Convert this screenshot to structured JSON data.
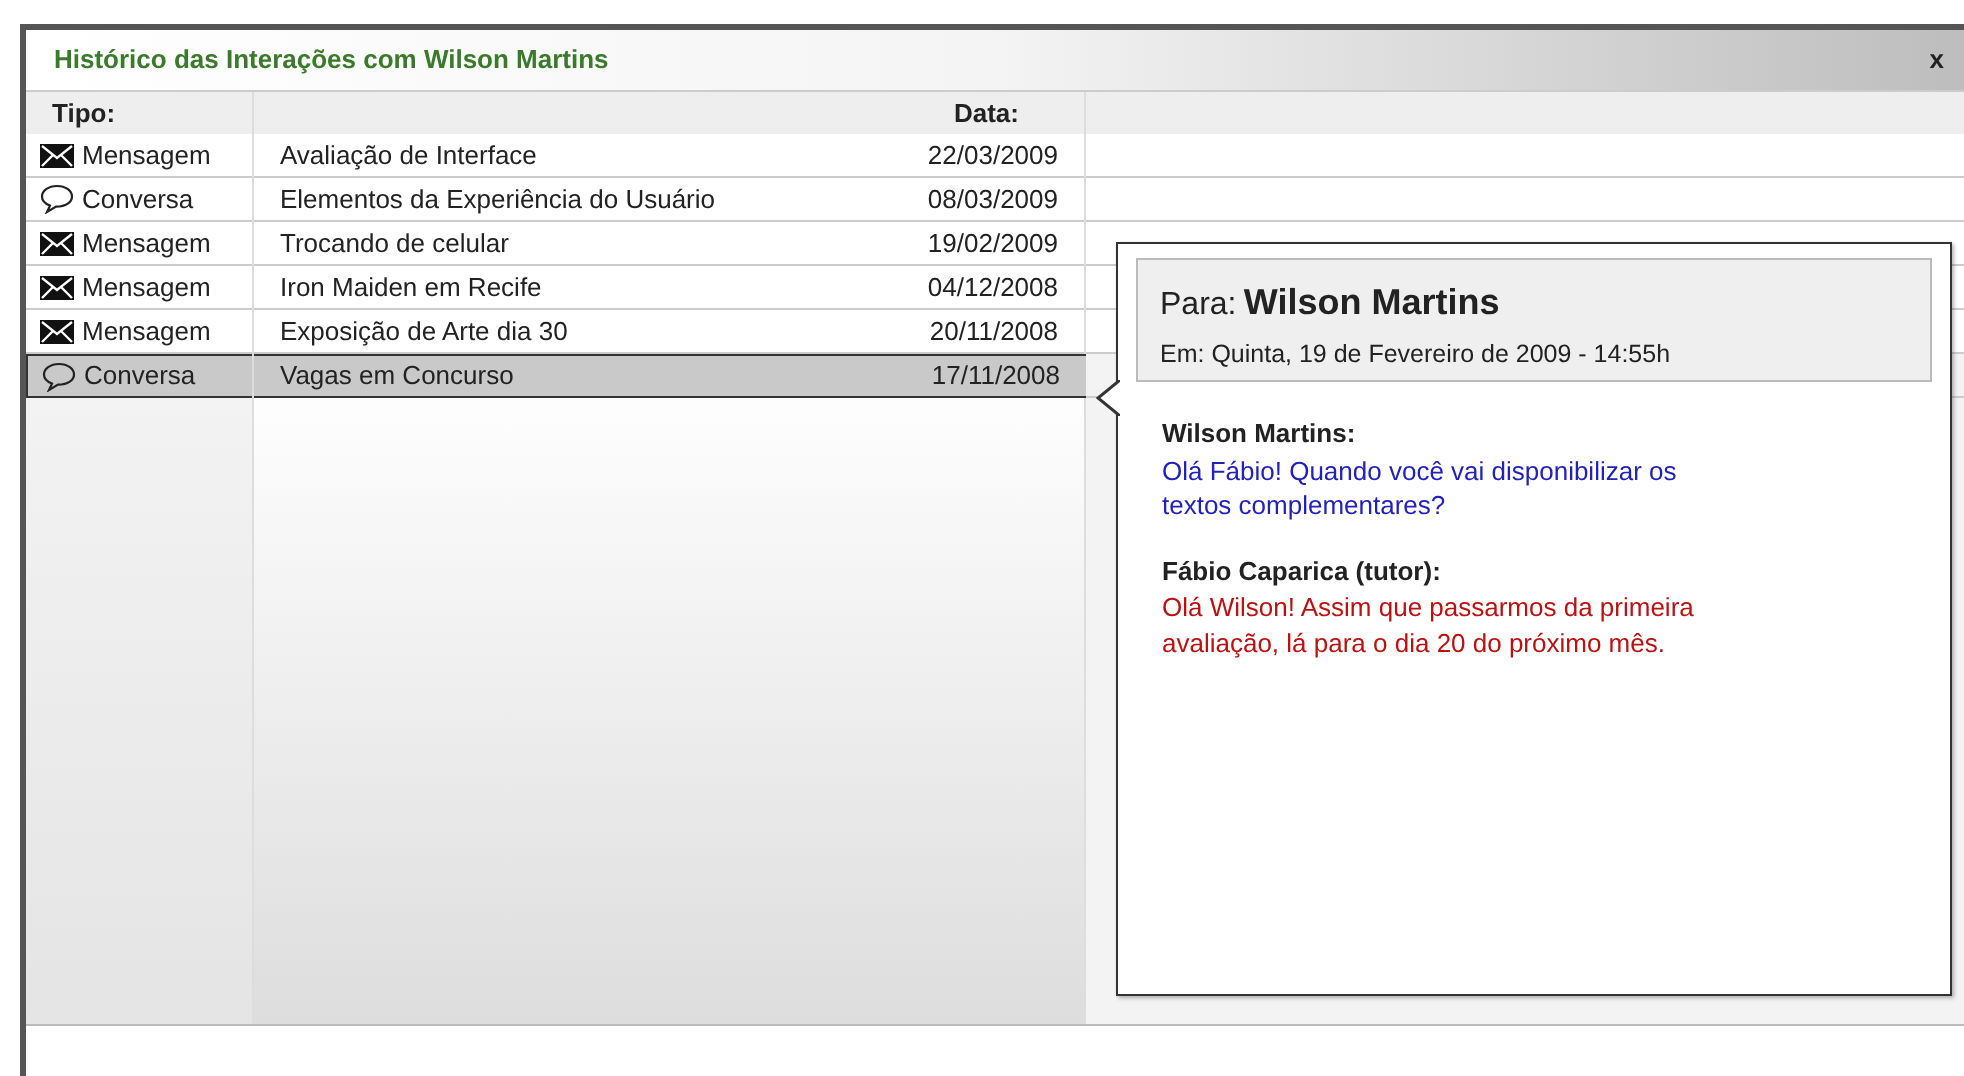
{
  "window": {
    "title": "Histórico das Interações com Wilson Martins",
    "close": "x"
  },
  "table": {
    "columns": [
      "Tipo:",
      "",
      "Data:"
    ],
    "rows": [
      {
        "kind": "message",
        "type": "Mensagem",
        "subject": "Avaliação de Interface",
        "date": "22/03/2009",
        "selected": false
      },
      {
        "kind": "chat",
        "type": "Conversa",
        "subject": "Elementos da Experiência do Usuário",
        "date": "08/03/2009",
        "selected": false
      },
      {
        "kind": "message",
        "type": "Mensagem",
        "subject": "Trocando de celular",
        "date": "19/02/2009",
        "selected": false
      },
      {
        "kind": "message",
        "type": "Mensagem",
        "subject": "Iron Maiden em Recife",
        "date": "04/12/2008",
        "selected": false
      },
      {
        "kind": "message",
        "type": "Mensagem",
        "subject": "Exposição de Arte dia 30",
        "date": "20/11/2008",
        "selected": false
      },
      {
        "kind": "chat",
        "type": "Conversa",
        "subject": "Vagas em Concurso",
        "date": "17/11/2008",
        "selected": true
      }
    ]
  },
  "detail": {
    "to_label": "Para:",
    "to_name": "Wilson Martins",
    "when": "Em: Quinta, 19 de Fevereiro de  2009 - 14:55h",
    "messages": [
      {
        "speaker": "Wilson Martins:",
        "text": "Olá Fábio! Quando você vai disponibilizar os textos complementares?",
        "color": "#2222bb"
      },
      {
        "speaker": "Fábio Caparica (tutor):",
        "text": "Olá Wilson!  Assim que passarmos da primeira avaliação, lá para o dia 20 do próximo mês.",
        "color": "#bb1111"
      }
    ]
  }
}
